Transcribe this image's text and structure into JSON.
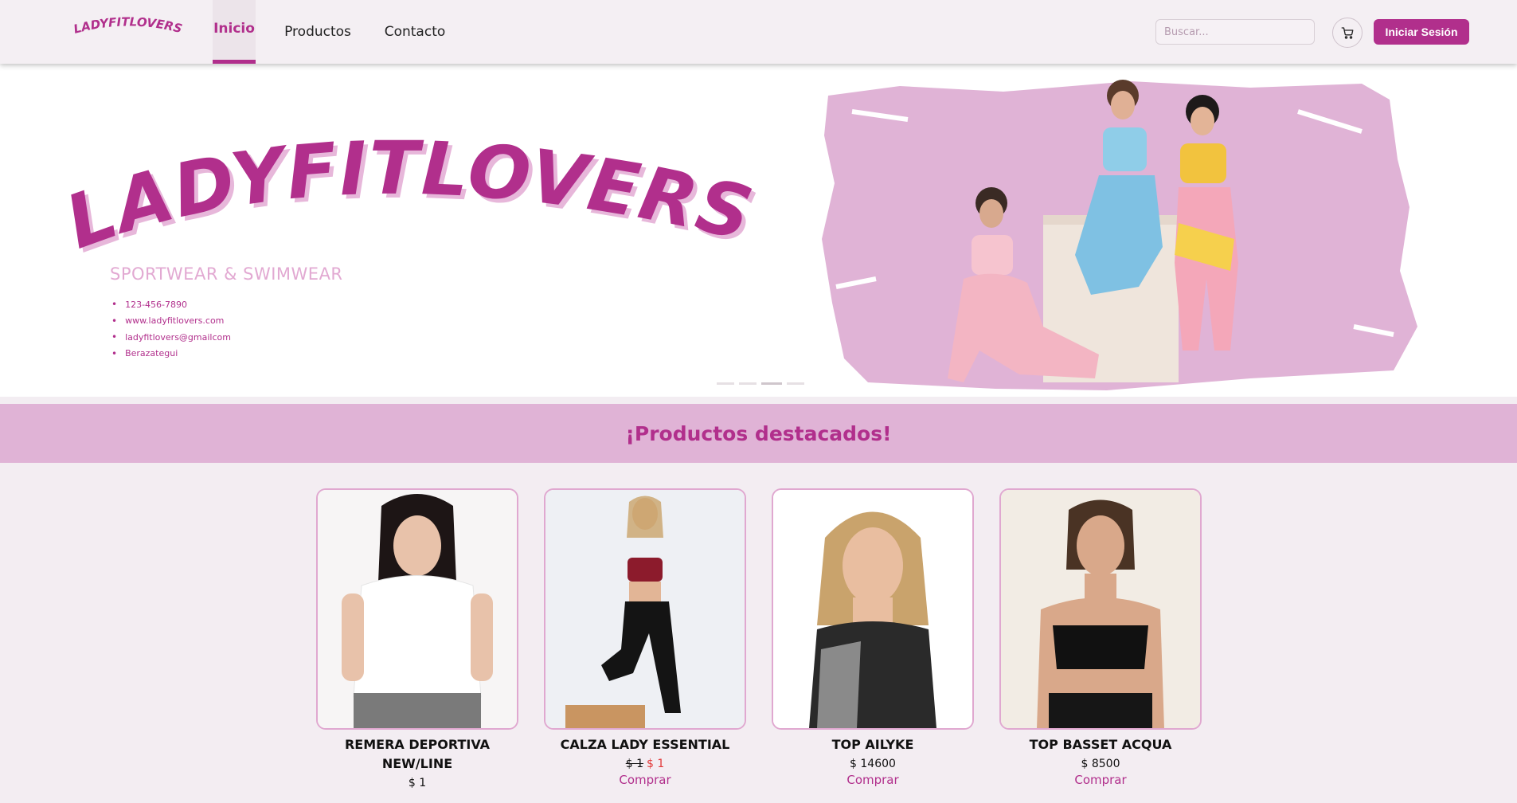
{
  "brand": {
    "name": "LADYFITLOVERS"
  },
  "nav": {
    "items": [
      {
        "label": "Inicio",
        "active": true
      },
      {
        "label": "Productos"
      },
      {
        "label": "Contacto"
      }
    ]
  },
  "search": {
    "placeholder": "Buscar...",
    "value": ""
  },
  "cart": {
    "icon": "cart-icon"
  },
  "login": {
    "label": "Iniciar Sesión"
  },
  "hero": {
    "title": "LADYFITLOVERS",
    "tagline": "SPORTWEAR & SWIMWEAR",
    "contacts": [
      "123-456-7890",
      "www.ladyfitlovers.com",
      "ladyfitlovers@gmailcom",
      "Berazategui"
    ],
    "slides_count": 4,
    "active_slide": 3
  },
  "featured": {
    "title": "¡Productos destacados!"
  },
  "products": [
    {
      "name": "REMERA DEPORTIVA NEW/LINE",
      "price": "$ 1",
      "buy": "Comprar"
    },
    {
      "name": "CALZA LADY ESSENTIAL",
      "old_price": "$ 1",
      "price": "$ 1",
      "buy": "Comprar"
    },
    {
      "name": "TOP AILYKE",
      "price": "$ 14600",
      "buy": "Comprar"
    },
    {
      "name": "TOP BASSET ACQUA",
      "price": "$ 8500",
      "buy": "Comprar"
    }
  ],
  "colors": {
    "brand": "#b12f8c",
    "banner": "#e0b3d6",
    "accent_light": "#e2a9d2",
    "sale": "#e23a3a",
    "page_bg": "#f3edf2"
  }
}
